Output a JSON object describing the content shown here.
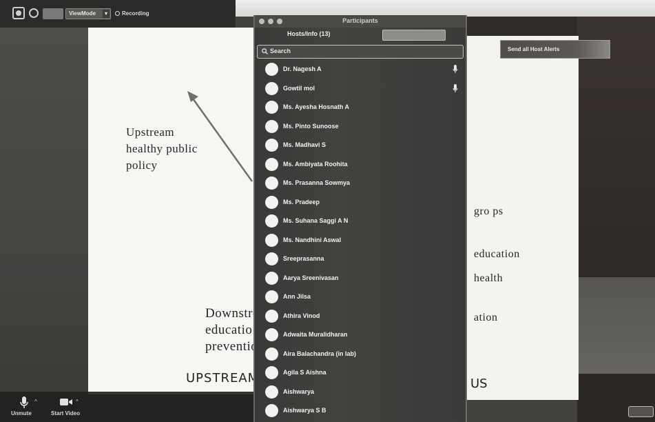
{
  "toolbar_top": {
    "view_mode": "ViewMode",
    "dropdown_caret": "▾",
    "recording_label": "Recording"
  },
  "slide": {
    "left_lines": [
      "Upstream",
      "healthy public",
      "policy"
    ],
    "downstream_lines": [
      "Downstre",
      "educatio",
      "preventio"
    ],
    "footer_left": "UPSTREAM",
    "right_lines": [
      "gro ps",
      "education",
      "health",
      "ation"
    ],
    "footer_right": "US"
  },
  "participants_panel": {
    "title": "Participants",
    "section_label": "Hosts/Info (13)",
    "search_placeholder": "Search",
    "participants": [
      {
        "name": "Dr. Nagesh A",
        "status_icon": "mic-icon"
      },
      {
        "name": "Gowtil mol",
        "status_icon": "mic-icon"
      },
      {
        "name": "Ms. Ayesha Hosnath A",
        "status_icon": ""
      },
      {
        "name": "Ms. Pinto Sunoose",
        "status_icon": ""
      },
      {
        "name": "Ms. Madhavi S",
        "status_icon": ""
      },
      {
        "name": "Ms. Ambiyata Roohita",
        "status_icon": ""
      },
      {
        "name": "Ms. Prasanna Sowmya",
        "status_icon": ""
      },
      {
        "name": "Ms. Pradeep",
        "status_icon": ""
      },
      {
        "name": "Ms. Suhana Saggi A N",
        "status_icon": ""
      },
      {
        "name": "Ms. Nandhini Aswal",
        "status_icon": ""
      },
      {
        "name": "Sreeprasanna",
        "status_icon": ""
      },
      {
        "name": "Aarya Sreenivasan",
        "status_icon": ""
      },
      {
        "name": "Ann Jilsa",
        "status_icon": ""
      },
      {
        "name": "Athira Vinod",
        "status_icon": ""
      },
      {
        "name": "Adwaita Muralidharan",
        "status_icon": ""
      },
      {
        "name": "Aira Balachandra (in lab)",
        "status_icon": ""
      },
      {
        "name": "Agila S Aishna",
        "status_icon": ""
      },
      {
        "name": "Aishwarya",
        "status_icon": ""
      },
      {
        "name": "Aishwarya S B",
        "status_icon": ""
      }
    ]
  },
  "host_alert_button": "Send all Host Alerts",
  "bottom_toolbar": {
    "unmute_label": "Unmute",
    "start_video_label": "Start Video",
    "caret": "^"
  },
  "colors": {
    "panel_bg": "#3d3c3a",
    "slide_bg": "#f6f6f3",
    "avatar": "#f2f2f0",
    "topbar_bg": "#2c2b29"
  }
}
